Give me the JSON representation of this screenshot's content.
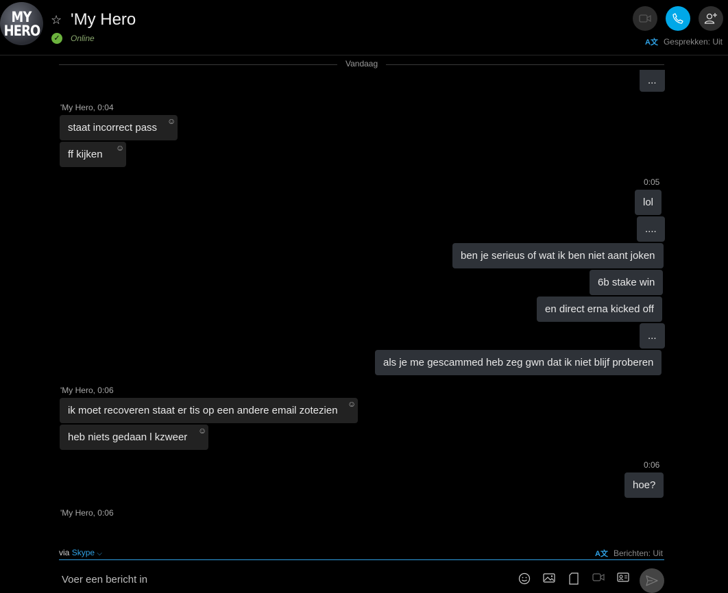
{
  "header": {
    "avatar_line1": "MY",
    "avatar_line2": "HERO",
    "title": "'My Hero",
    "status": "Online",
    "translator_icon": "A文",
    "conversations_label": "Gesprekken: Uit"
  },
  "divider": {
    "label": "Vandaag"
  },
  "top_bubble": "...",
  "groups": {
    "g1": {
      "meta": "'My Hero, 0:04",
      "m1": "staat incorrect pass",
      "m2": "ff kijken"
    },
    "g2": {
      "meta": "0:05",
      "m1": "lol",
      "m2": "....",
      "m3": "ben je serieus of wat ik ben niet aant joken",
      "m4": "6b stake win",
      "m5": "en direct erna kicked off",
      "m6": "...",
      "m7": "als je me gescammed heb zeg gwn dat ik niet blijf proberen"
    },
    "g3": {
      "meta": "'My Hero, 0:06",
      "m1": "ik moet recoveren staat er tis op een andere email zotezien",
      "m2": "heb niets gedaan l kzweer"
    },
    "g4": {
      "meta": "0:06",
      "m1": "hoe?"
    },
    "g5": {
      "meta": "'My Hero, 0:06"
    }
  },
  "compose": {
    "via_label": "via",
    "service": "Skype",
    "translator_icon": "A文",
    "messages_label": "Berichten: Uit",
    "placeholder": "Voer een bericht in"
  },
  "icons": {
    "video": "video-camera-icon",
    "call": "phone-icon",
    "add": "add-person-icon",
    "star": "star-icon",
    "emoji": "emoji-icon",
    "image": "image-icon",
    "file": "file-icon",
    "video_message": "video-message-icon",
    "contact": "contact-card-icon",
    "send": "send-icon"
  },
  "colors": {
    "accent": "#00a8e8",
    "online": "#6cb33e",
    "incoming_bubble": "#222222",
    "outgoing_bubble": "#2e3238"
  }
}
